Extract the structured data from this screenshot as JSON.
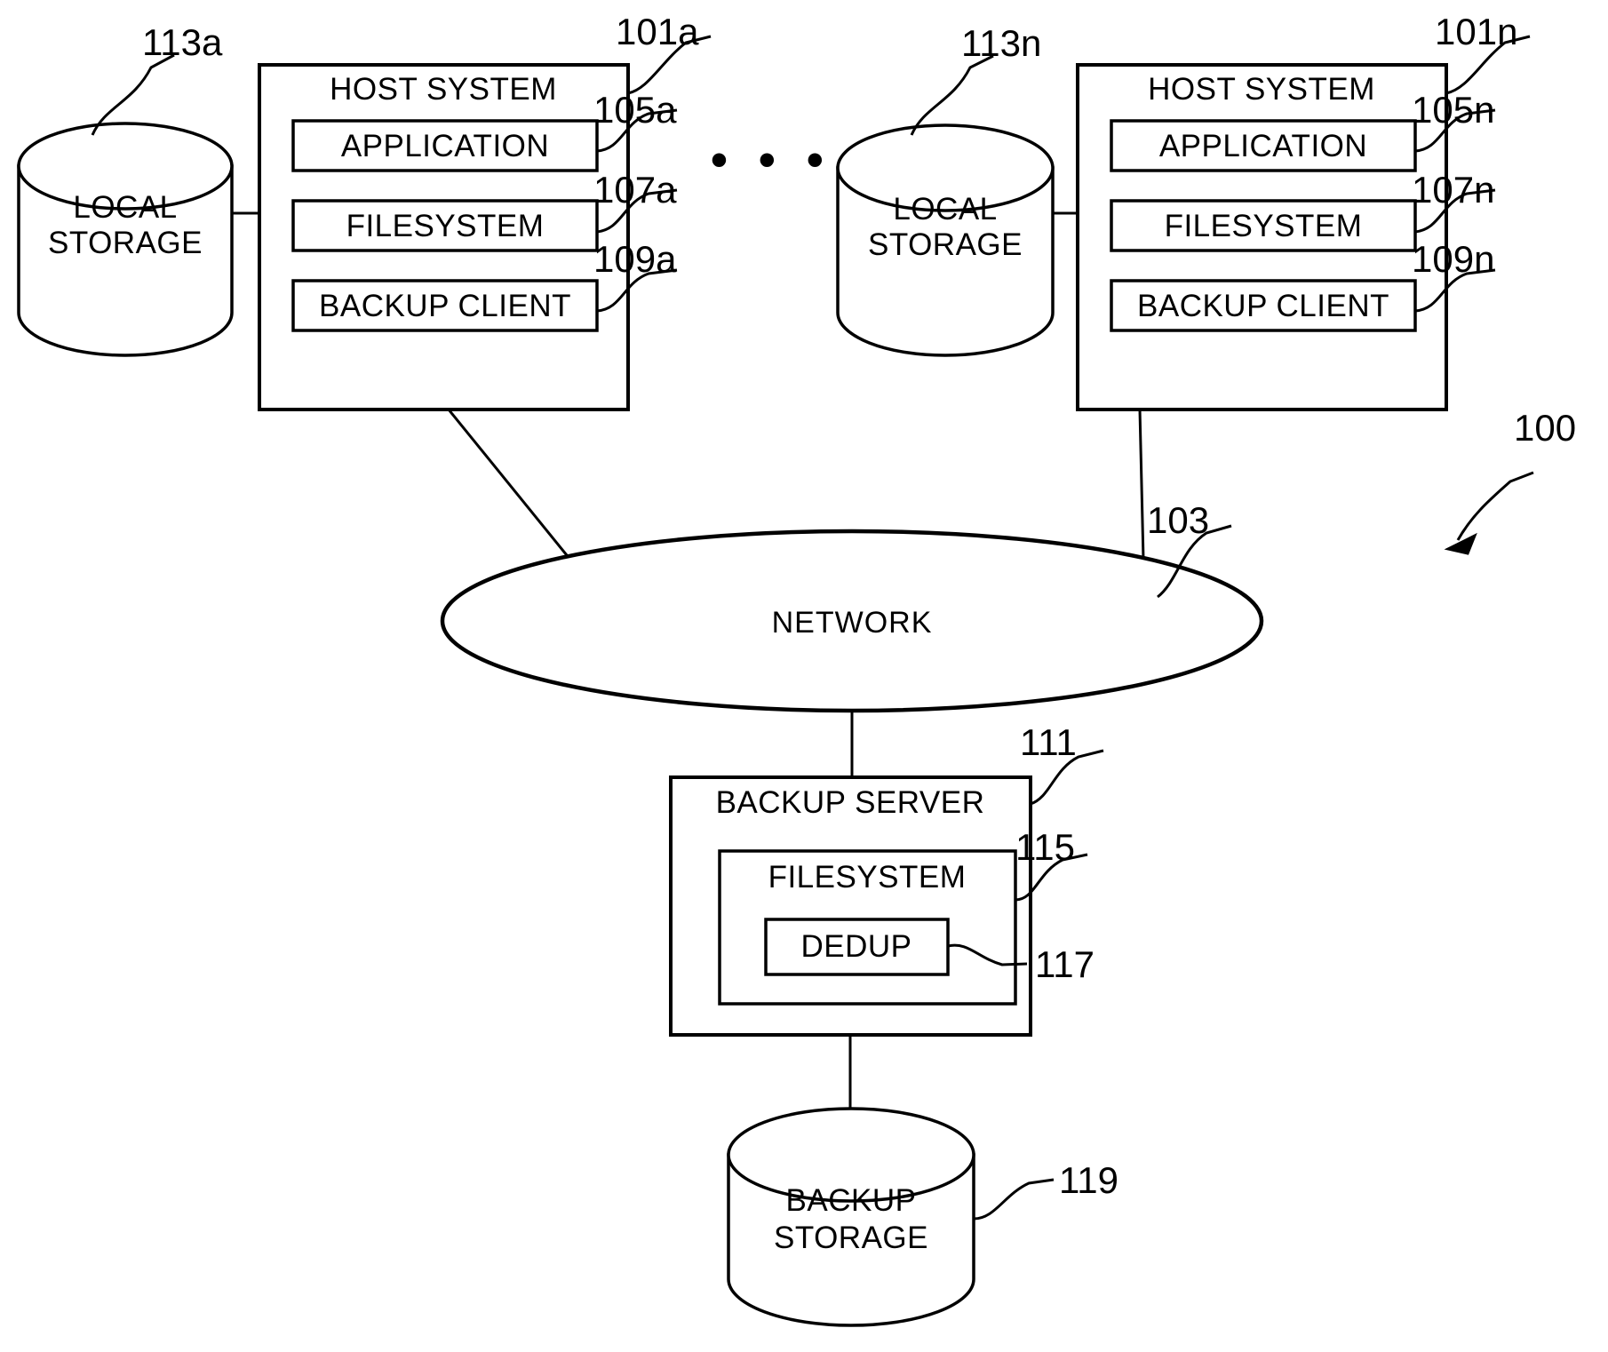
{
  "figure": {
    "reference_number": "100",
    "type": "patent-system-block-diagram"
  },
  "hosts": [
    {
      "id": "host-a",
      "title": "HOST SYSTEM",
      "ref": "101a",
      "modules": [
        {
          "label": "APPLICATION",
          "ref": "105a"
        },
        {
          "label": "FILESYSTEM",
          "ref": "107a"
        },
        {
          "label": "BACKUP CLIENT",
          "ref": "109a"
        }
      ],
      "storage": {
        "line1": "LOCAL",
        "line2": "STORAGE",
        "ref": "113a"
      }
    },
    {
      "id": "host-n",
      "title": "HOST SYSTEM",
      "ref": "101n",
      "modules": [
        {
          "label": "APPLICATION",
          "ref": "105n"
        },
        {
          "label": "FILESYSTEM",
          "ref": "107n"
        },
        {
          "label": "BACKUP CLIENT",
          "ref": "109n"
        }
      ],
      "storage": {
        "line1": "LOCAL",
        "line2": "STORAGE",
        "ref": "113n"
      }
    }
  ],
  "ellipsis": "• • •",
  "network": {
    "label": "NETWORK",
    "ref": "103"
  },
  "backup_server": {
    "title": "BACKUP SERVER",
    "ref": "111",
    "filesystem": {
      "label": "FILESYSTEM",
      "ref": "115"
    },
    "dedup": {
      "label": "DEDUP",
      "ref": "117"
    }
  },
  "backup_storage": {
    "line1": "BACKUP",
    "line2": "STORAGE",
    "ref": "119"
  },
  "colors": {
    "ink": "#000000",
    "paper": "#ffffff"
  }
}
